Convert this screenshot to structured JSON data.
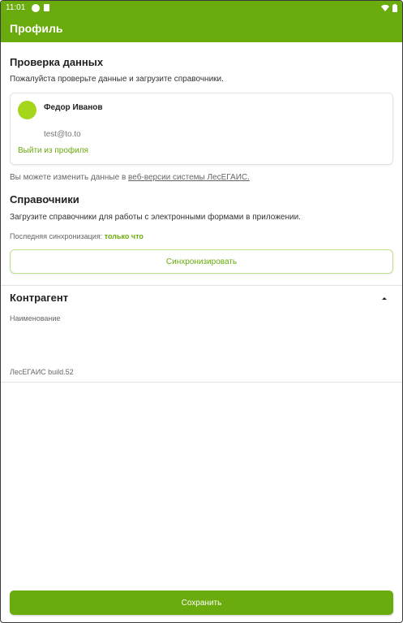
{
  "status_bar": {
    "time": "11:01",
    "icons": [
      "app-icon",
      "sim-card-icon",
      "wifi-icon",
      "battery-icon"
    ]
  },
  "app_bar": {
    "title": "Профиль"
  },
  "data_check": {
    "title": "Проверка данных",
    "description": "Пожалуйста проверьте данные и загрузите справочники."
  },
  "user_card": {
    "name": "Федор Иванов",
    "email": "test@to.to",
    "logout_label": "Выйти из профиля",
    "avatar_color": "#a5d61c"
  },
  "info": {
    "prefix": "Вы можете изменить данные в",
    "link_text": "веб-версии системы ЛесЕГАИС."
  },
  "references": {
    "title": "Справочники",
    "description": "Загрузите справочники для работы с электронными формами в приложении.",
    "last_sync_label": "Последняя синхронизация:",
    "last_sync_value": "только что",
    "sync_button": "Синхронизировать"
  },
  "contractor": {
    "title": "Контрагент",
    "name_label": "Наименование"
  },
  "build": {
    "label": "ЛесЕГАИС build.52"
  },
  "save_button": "Сохранить",
  "colors": {
    "accent": "#6aab0d",
    "link": "#6aab0d"
  }
}
